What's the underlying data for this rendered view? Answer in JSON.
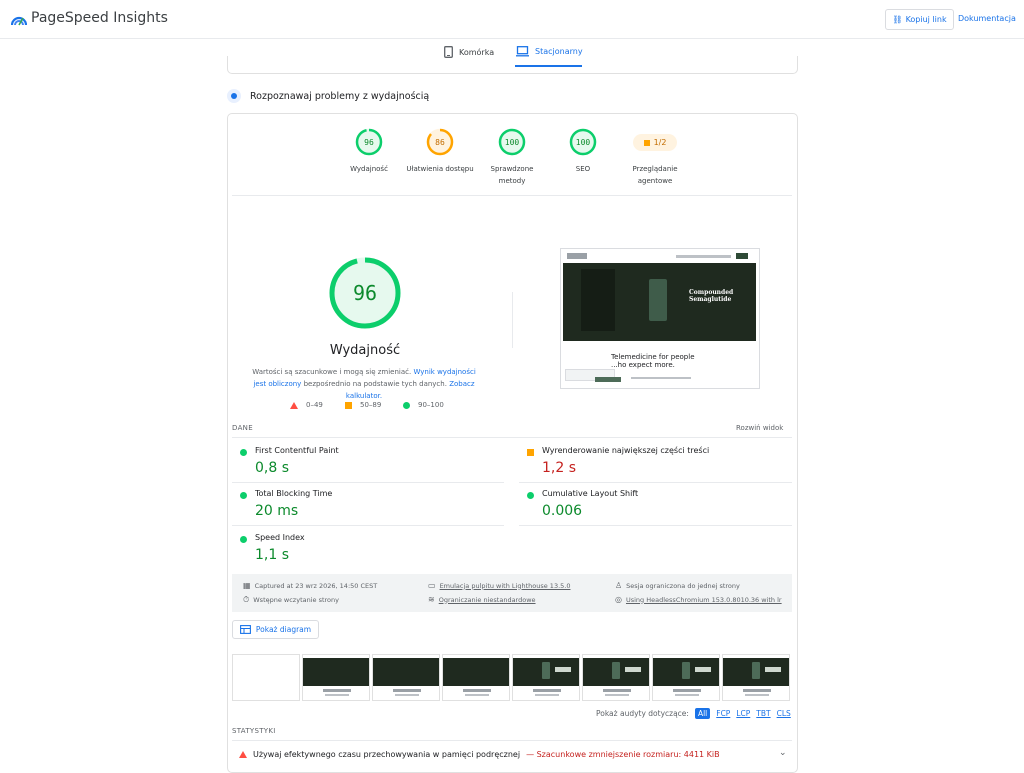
{
  "header": {
    "app_name": "PageSpeed Insights",
    "copy_link": "Kopiuj link",
    "docs": "Dokumentacja"
  },
  "tabs": [
    {
      "label": "Komórka",
      "icon": "phone-icon"
    },
    {
      "label": "Stacjonarny",
      "icon": "laptop-icon",
      "active": true
    }
  ],
  "section_title": "Rozpoznawaj problemy z wydajnością",
  "gauges": [
    {
      "value": "96",
      "label": "Wydajność",
      "color": "#0cce6b",
      "fraction": 0.96
    },
    {
      "value": "86",
      "label": "Ułatwienia dostępu",
      "color": "#ffa400",
      "fraction": 0.86
    },
    {
      "value": "100",
      "label": "Sprawdzone metody",
      "color": "#0cce6b",
      "fraction": 1.0
    },
    {
      "value": "100",
      "label": "SEO",
      "color": "#0cce6b",
      "fraction": 1.0
    }
  ],
  "agentic": {
    "value": "1/2",
    "label": "Przeglądanie agentowe",
    "color": "#ffa400"
  },
  "performance": {
    "score": "96",
    "fraction": 0.96,
    "label": "Wydajność",
    "desc_pre": "Wartości są szacunkowe i mogą się zmieniać.",
    "desc_link1": "Wynik wydajności jest obliczony",
    "desc_mid": "bezpośrednio na podstawie tych danych.",
    "desc_link2": "Zobacz kalkulator."
  },
  "legend": {
    "bad": "0–49",
    "avg": "50–89",
    "good": "90–100"
  },
  "screenshot": {
    "headline": "Compounded Semaglutide",
    "tagline": "Telemedicine for people who expect more.",
    "tagline_visible": "Telemedicine for people\n...ho expect more."
  },
  "metrics_header": {
    "title": "DANE",
    "expand": "Rozwiń widok"
  },
  "metrics": [
    {
      "name": "First Contentful Paint",
      "value": "0,8 s",
      "status": "good"
    },
    {
      "name": "Wyrenderowanie największej części treści",
      "value": "1,2 s",
      "status": "avg"
    },
    {
      "name": "Total Blocking Time",
      "value": "20 ms",
      "status": "good"
    },
    {
      "name": "Cumulative Layout Shift",
      "value": "0.006",
      "status": "good"
    },
    {
      "name": "Speed Index",
      "value": "1,1 s",
      "status": "good"
    }
  ],
  "env": {
    "captured": "Captured at 23 wrz 2026, 14:50 CEST",
    "emulation": "Emulacja pulpitu with Lighthouse 13.5.0",
    "session": "Sesja ograniczona do jednej strony",
    "initial": "Wstępne wczytanie strony",
    "throttling": "Ograniczanie niestandardowe",
    "browser": "Using HeadlessChromium 153.0.8010.36 with lr"
  },
  "diagram_button": "Pokaż diagram",
  "audits_filter": {
    "label": "Pokaż audyty dotyczące:",
    "options": [
      "All",
      "FCP",
      "LCP",
      "TBT",
      "CLS"
    ],
    "selected": "All"
  },
  "stats_title": "STATYSTYKI",
  "audit_row": {
    "text": "Używaj efektywnego czasu przechowywania w pamięci podręcznej",
    "estimate": "— Szacunkowe zmniejszenie rozmiaru: 4411 KiB"
  }
}
